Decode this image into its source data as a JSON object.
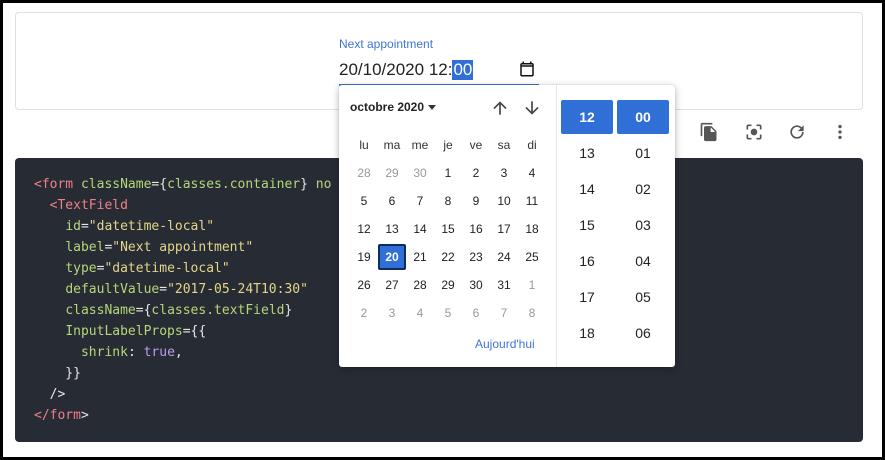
{
  "field": {
    "label": "Next appointment",
    "value_date": "20/10/2020",
    "value_hour": "12:",
    "value_minute": "00"
  },
  "toolbar": {
    "icons": [
      "copy-icon",
      "screenshot-icon",
      "reload-icon",
      "more-vert-icon"
    ]
  },
  "code": {
    "lines": [
      [
        {
          "t": "tag",
          "v": "<form "
        },
        {
          "t": "attr",
          "v": "className"
        },
        {
          "t": "punct",
          "v": "={"
        },
        {
          "t": "attr",
          "v": "classes.container"
        },
        {
          "t": "punct",
          "v": "} "
        },
        {
          "t": "attr",
          "v": "no"
        }
      ],
      [
        {
          "t": "punct",
          "v": "  "
        },
        {
          "t": "tag",
          "v": "<TextField"
        }
      ],
      [
        {
          "t": "punct",
          "v": "    "
        },
        {
          "t": "attr",
          "v": "id"
        },
        {
          "t": "punct",
          "v": "="
        },
        {
          "t": "str",
          "v": "\"datetime-local\""
        }
      ],
      [
        {
          "t": "punct",
          "v": "    "
        },
        {
          "t": "attr",
          "v": "label"
        },
        {
          "t": "punct",
          "v": "="
        },
        {
          "t": "str",
          "v": "\"Next appointment\""
        }
      ],
      [
        {
          "t": "punct",
          "v": "    "
        },
        {
          "t": "attr",
          "v": "type"
        },
        {
          "t": "punct",
          "v": "="
        },
        {
          "t": "str",
          "v": "\"datetime-local\""
        }
      ],
      [
        {
          "t": "punct",
          "v": "    "
        },
        {
          "t": "attr",
          "v": "defaultValue"
        },
        {
          "t": "punct",
          "v": "="
        },
        {
          "t": "str",
          "v": "\"2017-05-24T10:30\""
        }
      ],
      [
        {
          "t": "punct",
          "v": "    "
        },
        {
          "t": "attr",
          "v": "className"
        },
        {
          "t": "punct",
          "v": "={"
        },
        {
          "t": "attr",
          "v": "classes.textField"
        },
        {
          "t": "punct",
          "v": "}"
        }
      ],
      [
        {
          "t": "punct",
          "v": "    "
        },
        {
          "t": "attr",
          "v": "InputLabelProps"
        },
        {
          "t": "punct",
          "v": "={{"
        }
      ],
      [
        {
          "t": "punct",
          "v": "      "
        },
        {
          "t": "attr",
          "v": "shrink"
        },
        {
          "t": "punct",
          "v": ": "
        },
        {
          "t": "kw",
          "v": "true"
        },
        {
          "t": "punct",
          "v": ","
        }
      ],
      [
        {
          "t": "punct",
          "v": "    }}"
        }
      ],
      [
        {
          "t": "punct",
          "v": "  />"
        }
      ],
      [
        {
          "t": "tag",
          "v": "</form"
        },
        {
          "t": "punct",
          "v": ">"
        }
      ]
    ]
  },
  "picker": {
    "month_label": "octobre 2020",
    "weekdays": [
      "lu",
      "ma",
      "me",
      "je",
      "ve",
      "sa",
      "di"
    ],
    "weeks": [
      [
        {
          "d": "28",
          "m": true
        },
        {
          "d": "29",
          "m": true
        },
        {
          "d": "30",
          "m": true
        },
        {
          "d": "1"
        },
        {
          "d": "2"
        },
        {
          "d": "3"
        },
        {
          "d": "4"
        }
      ],
      [
        {
          "d": "5"
        },
        {
          "d": "6"
        },
        {
          "d": "7"
        },
        {
          "d": "8"
        },
        {
          "d": "9"
        },
        {
          "d": "10"
        },
        {
          "d": "11"
        }
      ],
      [
        {
          "d": "12"
        },
        {
          "d": "13"
        },
        {
          "d": "14"
        },
        {
          "d": "15"
        },
        {
          "d": "16"
        },
        {
          "d": "17"
        },
        {
          "d": "18"
        }
      ],
      [
        {
          "d": "19"
        },
        {
          "d": "20",
          "sel": true
        },
        {
          "d": "21"
        },
        {
          "d": "22"
        },
        {
          "d": "23"
        },
        {
          "d": "24"
        },
        {
          "d": "25"
        }
      ],
      [
        {
          "d": "26"
        },
        {
          "d": "27"
        },
        {
          "d": "28"
        },
        {
          "d": "29"
        },
        {
          "d": "30"
        },
        {
          "d": "31"
        },
        {
          "d": "1",
          "m": true
        }
      ],
      [
        {
          "d": "2",
          "m": true
        },
        {
          "d": "3",
          "m": true
        },
        {
          "d": "4",
          "m": true
        },
        {
          "d": "5",
          "m": true
        },
        {
          "d": "6",
          "m": true
        },
        {
          "d": "7",
          "m": true
        },
        {
          "d": "8",
          "m": true
        }
      ]
    ],
    "today_label": "Aujourd'hui",
    "hours": [
      "12",
      "13",
      "14",
      "15",
      "16",
      "17",
      "18"
    ],
    "minutes": [
      "00",
      "01",
      "02",
      "03",
      "04",
      "05",
      "06"
    ],
    "selected_hour": "12",
    "selected_minute": "00"
  },
  "colors": {
    "accent": "#2f6fd6",
    "link": "#3f74d6",
    "code_bg": "#272c34"
  }
}
